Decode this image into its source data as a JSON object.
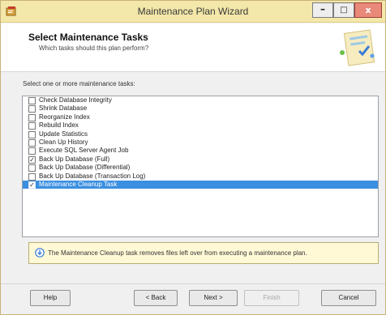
{
  "window": {
    "title": "Maintenance Plan Wizard",
    "app_icon": "wizard-app-icon",
    "minimize_glyph": "–",
    "maximize_glyph": "□",
    "close_glyph": "x"
  },
  "header": {
    "title": "Select Maintenance Tasks",
    "subtitle": "Which tasks should this plan perform?",
    "graphic": "wizard-banner-graphic"
  },
  "tasks": {
    "label": "Select one or more maintenance tasks:",
    "items": [
      {
        "label": "Check Database Integrity",
        "checked": false,
        "selected": false
      },
      {
        "label": "Shrink Database",
        "checked": false,
        "selected": false
      },
      {
        "label": "Reorganize Index",
        "checked": false,
        "selected": false
      },
      {
        "label": "Rebuild Index",
        "checked": false,
        "selected": false
      },
      {
        "label": "Update Statistics",
        "checked": false,
        "selected": false
      },
      {
        "label": "Clean Up History",
        "checked": false,
        "selected": false
      },
      {
        "label": "Execute SQL Server Agent Job",
        "checked": false,
        "selected": false
      },
      {
        "label": "Back Up Database (Full)",
        "checked": true,
        "selected": false
      },
      {
        "label": "Back Up Database (Differential)",
        "checked": false,
        "selected": false
      },
      {
        "label": "Back Up Database (Transaction Log)",
        "checked": false,
        "selected": false
      },
      {
        "label": "Maintenance Cleanup Task",
        "checked": true,
        "selected": true
      }
    ],
    "check_glyph": "✓"
  },
  "description": {
    "icon": "info-icon",
    "text": "The Maintenance Cleanup task removes files left over from executing a maintenance plan."
  },
  "colors": {
    "title_bar": "#f3e7a9",
    "selection": "#3b8fe0",
    "info_box": "#fff9d6",
    "close_button": "#e8897a"
  },
  "buttons": {
    "help": {
      "label": "Help",
      "enabled": true
    },
    "back": {
      "label": "< Back",
      "enabled": true
    },
    "next": {
      "label": "Next >",
      "enabled": true
    },
    "finish": {
      "label": "Finish",
      "enabled": false
    },
    "cancel": {
      "label": "Cancel",
      "enabled": true
    }
  }
}
